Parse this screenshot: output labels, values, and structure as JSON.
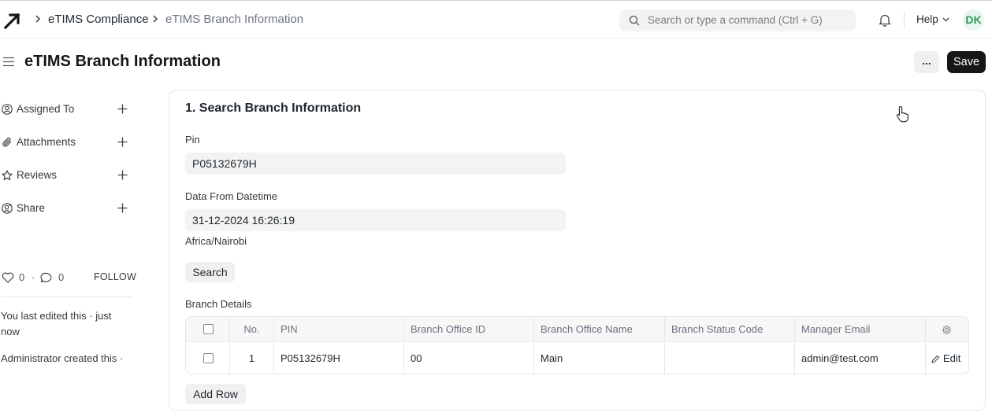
{
  "breadcrumb": {
    "module": "eTIMS Compliance",
    "doctype": "eTIMS Branch Information"
  },
  "navbar": {
    "search_placeholder": "Search or type a command (Ctrl + G)",
    "help_label": "Help",
    "avatar_initials": "DK"
  },
  "page": {
    "title": "eTIMS Branch Information",
    "more_label": "...",
    "save_label": "Save"
  },
  "sidebar": {
    "items": [
      {
        "label": "Assigned To",
        "icon": "assign-icon"
      },
      {
        "label": "Attachments",
        "icon": "paperclip-icon"
      },
      {
        "label": "Reviews",
        "icon": "star-icon"
      },
      {
        "label": "Share",
        "icon": "share-icon"
      }
    ],
    "likes": "0",
    "dot": "·",
    "comments": "0",
    "follow_label": "FOLLOW",
    "activity_1": "You last edited this · just now",
    "activity_2": "Administrator created this ·"
  },
  "form": {
    "section_title": "1. Search Branch Information",
    "pin_label": "Pin",
    "pin_value": "P05132679H",
    "datetime_label": "Data From Datetime",
    "datetime_value": "31-12-2024 16:26:19",
    "timezone": "Africa/Nairobi",
    "search_button": "Search",
    "branch_details_label": "Branch Details",
    "add_row_button": "Add Row"
  },
  "table": {
    "columns": [
      "No.",
      "PIN",
      "Branch Office ID",
      "Branch Office Name",
      "Branch Status Code",
      "Manager Email"
    ],
    "rows": [
      {
        "no": "1",
        "pin": "P05132679H",
        "branch_office_id": "00",
        "branch_office_name": "Main",
        "branch_status_code": "",
        "manager_email": "admin@test.com",
        "edit_label": "Edit"
      }
    ]
  },
  "colors": {
    "accent_dark": "#171717",
    "avatar_bg": "#e7f6ec",
    "avatar_fg": "#2f9a5a"
  }
}
